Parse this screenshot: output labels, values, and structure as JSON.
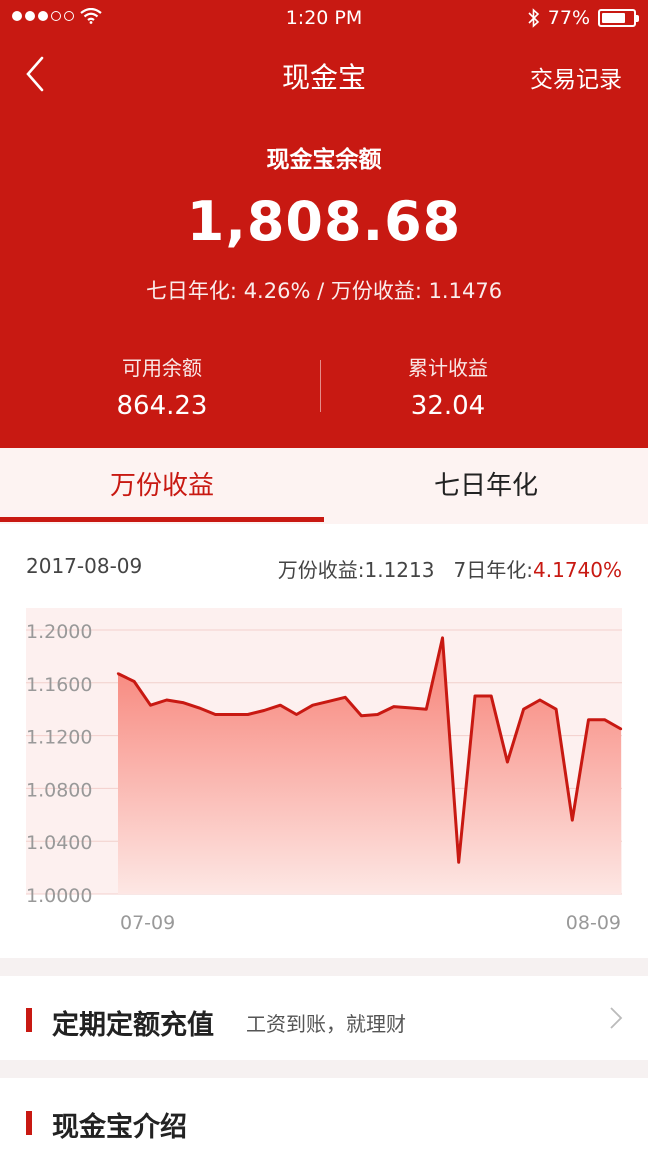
{
  "status_bar": {
    "time": "1:20 PM",
    "battery": "77%",
    "battery_level": 0.77
  },
  "nav": {
    "title": "现金宝",
    "right_action": "交易记录"
  },
  "balance": {
    "label": "现金宝余额",
    "amount": "1,808.68",
    "sub": "七日年化: 4.26% / 万份收益: 1.1476",
    "available_label": "可用余额",
    "available_value": "864.23",
    "cumulative_label": "累计收益",
    "cumulative_value": "32.04"
  },
  "tabs": [
    {
      "label": "万份收益",
      "active": true
    },
    {
      "label": "七日年化",
      "active": false
    }
  ],
  "chart_meta": {
    "date": "2017-08-09",
    "wanfen_text": "万份收益:1.1213",
    "seven_label": "7日年化:",
    "seven_value": "4.1740%"
  },
  "chart_data": {
    "type": "area",
    "ylim": [
      1.0,
      1.2
    ],
    "y_ticks": [
      "1.2000",
      "1.1600",
      "1.1200",
      "1.0800",
      "1.0400",
      "1.0000"
    ],
    "x_labels": [
      "07-09",
      "08-09"
    ],
    "values": [
      1.167,
      1.161,
      1.143,
      1.147,
      1.145,
      1.141,
      1.136,
      1.136,
      1.136,
      1.139,
      1.143,
      1.136,
      1.143,
      1.146,
      1.149,
      1.135,
      1.136,
      1.142,
      1.141,
      1.14,
      1.194,
      1.024,
      1.15,
      1.15,
      1.1,
      1.14,
      1.147,
      1.14,
      1.056,
      1.132,
      1.132,
      1.125
    ],
    "colors": {
      "line": "#c81912",
      "fill_top": "#f77d72",
      "fill_bottom": "#fde7e4",
      "plot_bg": "#fdf0ef"
    }
  },
  "cards": {
    "recharge": {
      "title": "定期定额充值",
      "subtitle": "工资到账，就理财"
    },
    "intro": {
      "title": "现金宝介绍"
    }
  },
  "colors": {
    "primary": "#c81912",
    "background": "#f6f1f1"
  }
}
